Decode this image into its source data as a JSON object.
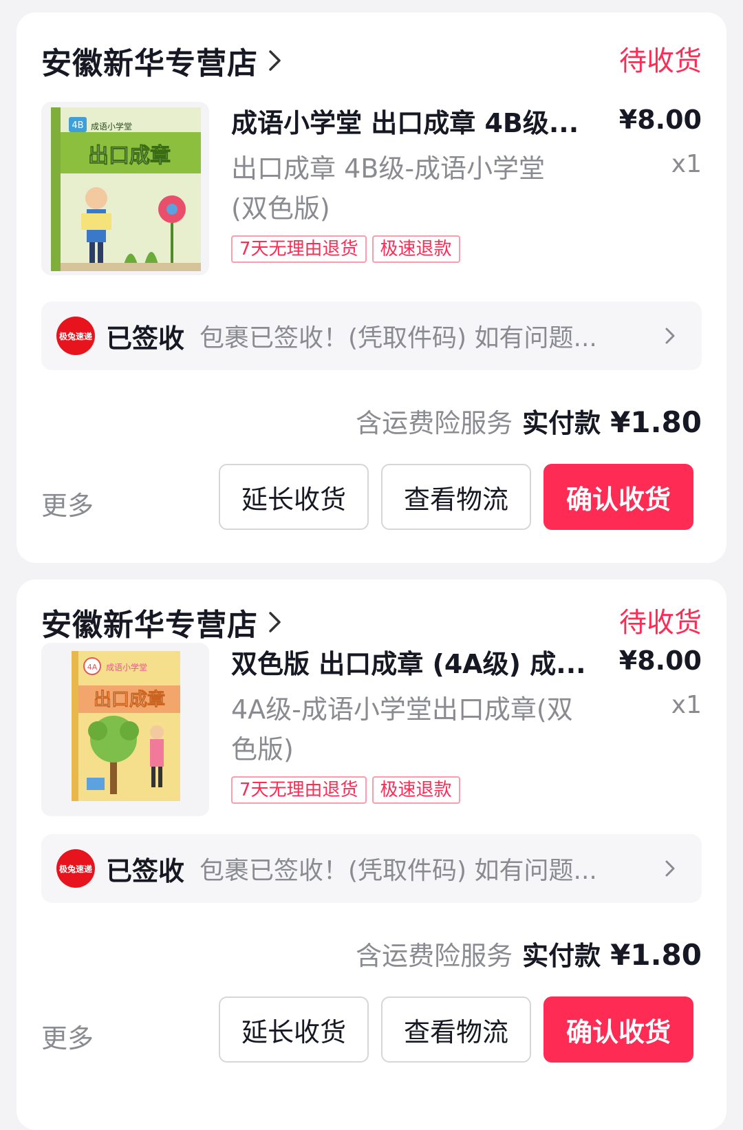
{
  "colors": {
    "accent": "#fe2c55",
    "muted": "#8a8b91",
    "background": "#f3f3f6"
  },
  "orders": [
    {
      "shop_name": "安徽新华专营店",
      "status": "待收货",
      "product_title": "成语小学堂 出口成章 4B级...",
      "price": "¥8.00",
      "sku": "出口成章 4B级-成语小学堂(双色版)",
      "quantity": "x1",
      "tags": [
        "7天无理由退货",
        "极速退款"
      ],
      "book_cover_text": {
        "badge": "4B",
        "series": "成语小学堂",
        "title": "出口成章"
      },
      "logistics": {
        "courier": "极兔速递",
        "state": "已签收",
        "desc": "包裹已签收！(凭取件码) 如有问题..."
      },
      "payment": {
        "note": "含运费险服务",
        "label": "实付款",
        "amount": "¥1.80"
      },
      "actions": {
        "more": "更多",
        "extend": "延长收货",
        "track": "查看物流",
        "confirm": "确认收货"
      }
    },
    {
      "shop_name": "安徽新华专营店",
      "status": "待收货",
      "product_title": "双色版 出口成章 (4A级) 成...",
      "price": "¥8.00",
      "sku": "4A级-成语小学堂出口成章(双色版)",
      "quantity": "x1",
      "tags": [
        "7天无理由退货",
        "极速退款"
      ],
      "book_cover_text": {
        "badge": "4A",
        "series": "成语小学堂",
        "title": "出口成章"
      },
      "logistics": {
        "courier": "极兔速递",
        "state": "已签收",
        "desc": "包裹已签收！(凭取件码) 如有问题..."
      },
      "payment": {
        "note": "含运费险服务",
        "label": "实付款",
        "amount": "¥1.80"
      },
      "actions": {
        "more": "更多",
        "extend": "延长收货",
        "track": "查看物流",
        "confirm": "确认收货"
      }
    }
  ]
}
